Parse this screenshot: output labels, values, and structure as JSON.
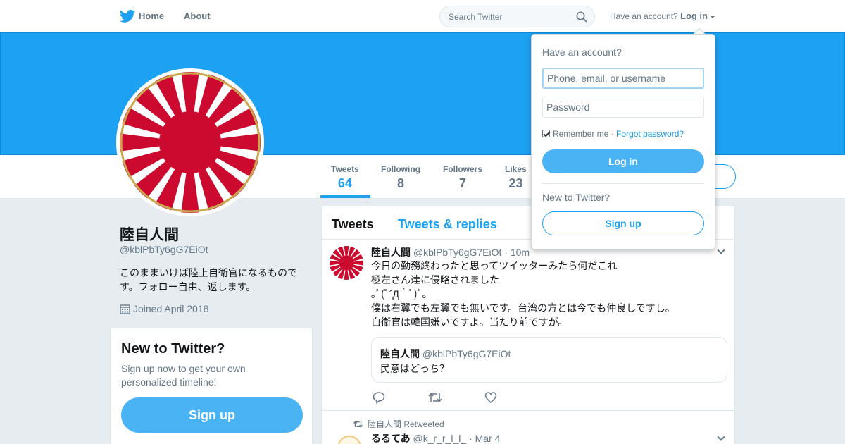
{
  "nav": {
    "home": "Home",
    "about": "About"
  },
  "search": {
    "placeholder": "Search Twitter"
  },
  "account": {
    "have_account": "Have an account?",
    "login": "Log in"
  },
  "stats": [
    {
      "label": "Tweets",
      "value": "64"
    },
    {
      "label": "Following",
      "value": "8"
    },
    {
      "label": "Followers",
      "value": "7"
    },
    {
      "label": "Likes",
      "value": "23"
    }
  ],
  "profile": {
    "name": "陸自人間",
    "handle": "@kblPbTy6gG7EiOt",
    "bio": "このままいけば陸上自衛官になるものです。フォロー自由、返します。",
    "joined": "Joined April 2018"
  },
  "signup_card": {
    "title": "New to Twitter?",
    "text": "Sign up now to get your own personalized timeline!",
    "button": "Sign up"
  },
  "timeline": {
    "tabs": [
      "Tweets",
      "Tweets & replies"
    ],
    "tweet1": {
      "name": "陸自人間",
      "handle": "@kblPbTy6gG7EiOt",
      "time": "· 10m",
      "lines": [
        "今日の勤務終わったと思ってツイッターみたら何だこれ",
        "極左さん達に侵略されました",
        "｡ﾟ(ﾟ´Д｀ﾟ)ﾟ｡",
        "僕は右翼でも左翼でも無いです。台湾の方とは今でも仲良しですし。",
        "自衛官は韓国嫌いですよ。当たり前ですが。"
      ],
      "quote": {
        "name": "陸自人間",
        "handle": "@kblPbTy6gG7EiOt",
        "text": "民意はどっち？"
      }
    },
    "retweet_context": "陸自人間 Retweeted",
    "tweet2": {
      "name": "るるてあ",
      "handle": "@k_r_r_l_l_",
      "time": "· Mar 4"
    }
  },
  "login_dropdown": {
    "title": "Have an account?",
    "username_placeholder": "Phone, email, or username",
    "password_placeholder": "Password",
    "remember": "Remember me",
    "separator": " · ",
    "forgot": "Forgot password?",
    "login_button": "Log in",
    "new_to_twitter": "New to Twitter?",
    "signup_button": "Sign up"
  },
  "colors": {
    "brand": "#1da1f2",
    "button": "#4ab3f4",
    "flag_red": "#cc0a2f"
  },
  "icons": [
    "twitter-bird-icon",
    "search-icon",
    "calendar-icon",
    "reply-icon",
    "retweet-icon",
    "like-icon",
    "chevron-down-icon"
  ]
}
